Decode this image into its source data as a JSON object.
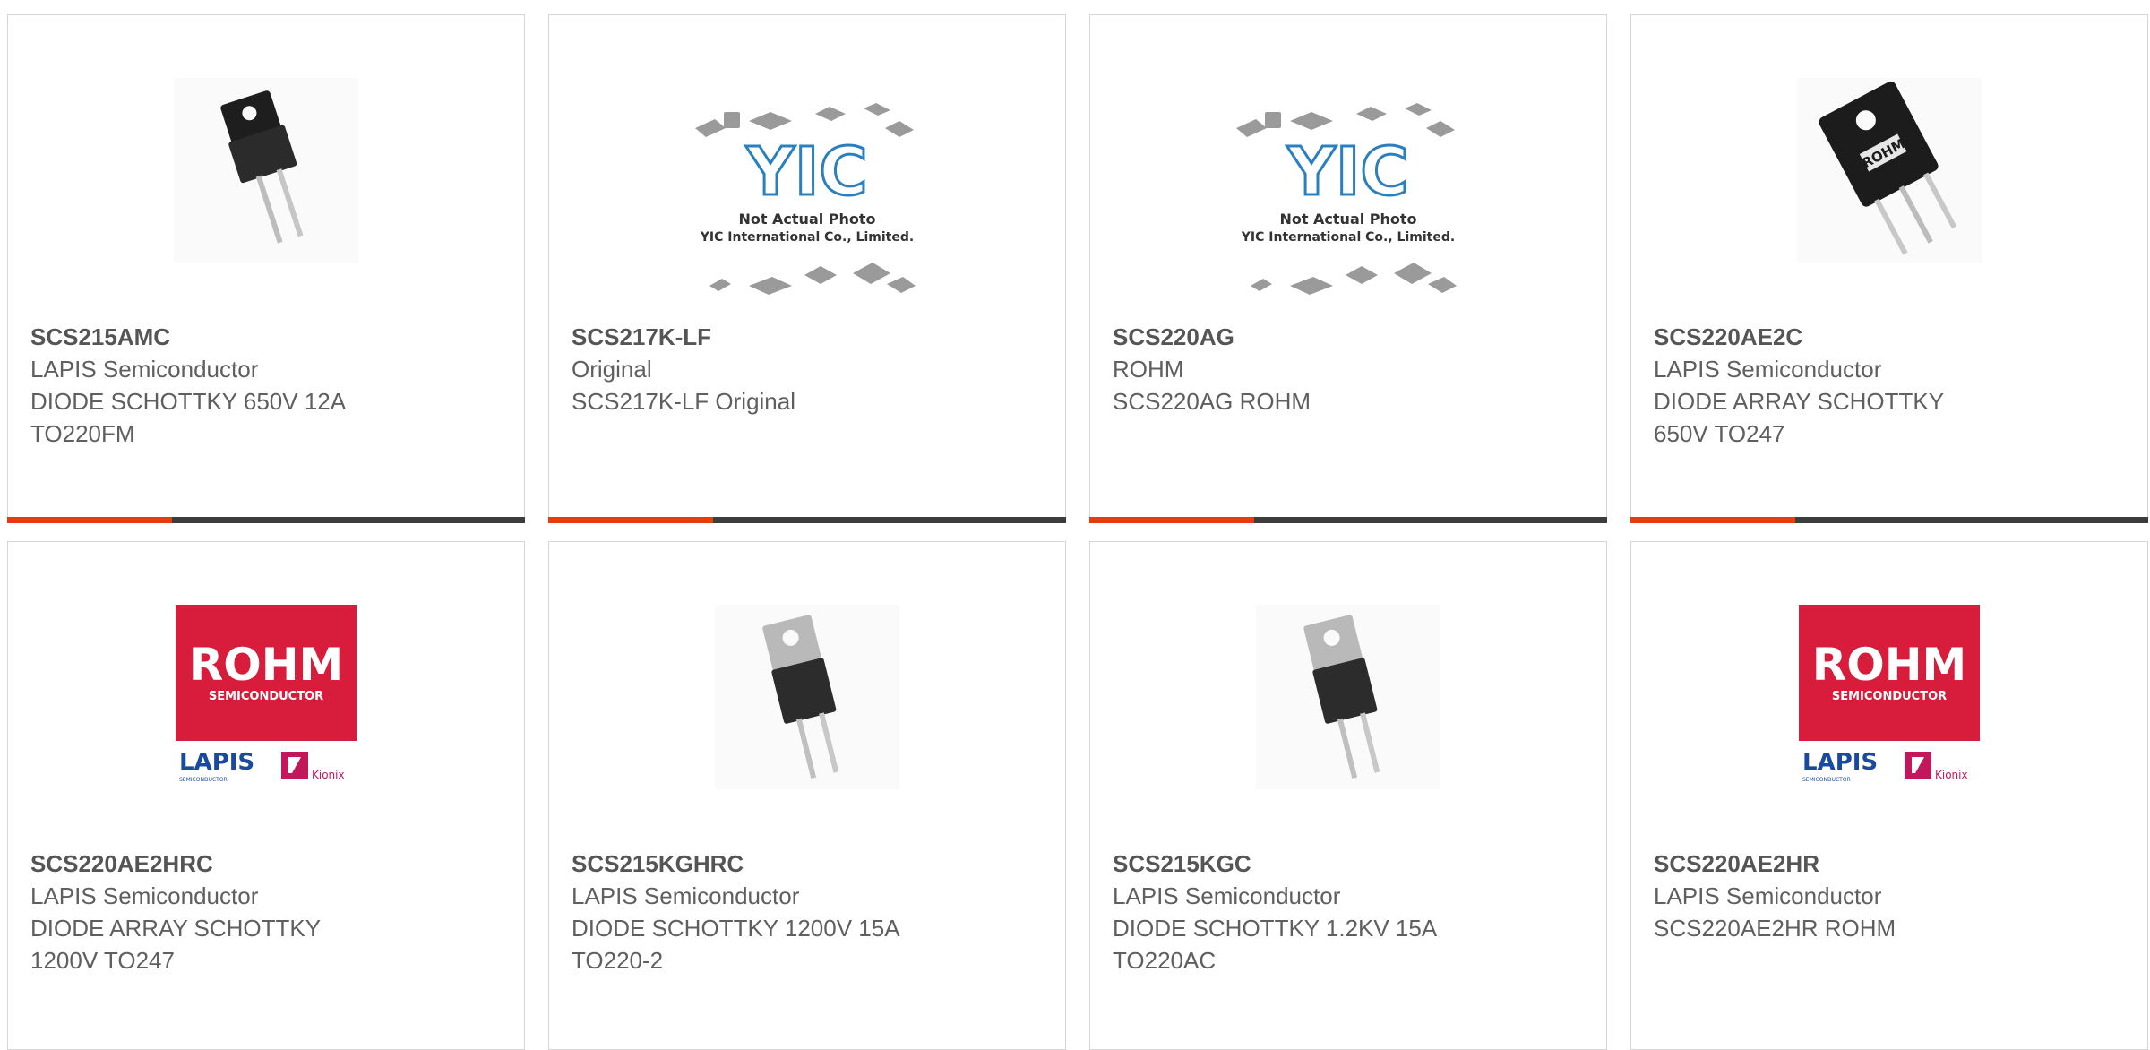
{
  "brand_colors": {
    "accent": "#e53c12",
    "bar_dark": "#3d3d3d",
    "rohm_red": "#d71d3b"
  },
  "products": [
    {
      "part_number": "SCS215AMC",
      "manufacturer": "LAPIS Semiconductor",
      "description_line1": "DIODE SCHOTTKY 650V 12A",
      "description_line2": "TO220FM",
      "image": "to220fm-package-icon"
    },
    {
      "part_number": "SCS217K-LF",
      "manufacturer": "Original",
      "description_line1": "SCS217K-LF Original",
      "description_line2": "",
      "image": "yic-placeholder-icon",
      "image_text": {
        "note": "Not Actual Photo",
        "company": "YIC International Co., Limited."
      }
    },
    {
      "part_number": "SCS220AG",
      "manufacturer": "ROHM",
      "description_line1": "SCS220AG ROHM",
      "description_line2": "",
      "image": "yic-placeholder-icon",
      "image_text": {
        "note": "Not Actual Photo",
        "company": "YIC International Co., Limited."
      }
    },
    {
      "part_number": "SCS220AE2C",
      "manufacturer": "LAPIS Semiconductor",
      "description_line1": "DIODE ARRAY SCHOTTKY",
      "description_line2": "650V TO247",
      "image": "to247-package-icon",
      "image_text": {
        "marking": "ROHM"
      }
    },
    {
      "part_number": "SCS220AE2HRC",
      "manufacturer": "LAPIS Semiconductor",
      "description_line1": "DIODE ARRAY SCHOTTKY",
      "description_line2": "1200V TO247",
      "image": "rohm-lapis-logo",
      "image_text": {
        "brand": "ROHM",
        "sub": "SEMICONDUCTOR",
        "lapis": "LAPIS",
        "lapis_sub": "SEMICONDUCTOR",
        "kionix": "Kionix"
      }
    },
    {
      "part_number": "SCS215KGHRC",
      "manufacturer": "LAPIS Semiconductor",
      "description_line1": "DIODE SCHOTTKY 1200V 15A",
      "description_line2": "TO220-2",
      "image": "to220-2-package-icon"
    },
    {
      "part_number": "SCS215KGC",
      "manufacturer": "LAPIS Semiconductor",
      "description_line1": "DIODE SCHOTTKY 1.2KV 15A",
      "description_line2": "TO220AC",
      "image": "to220-2-package-icon"
    },
    {
      "part_number": "SCS220AE2HR",
      "manufacturer": "LAPIS Semiconductor",
      "description_line1": "SCS220AE2HR ROHM",
      "description_line2": "",
      "image": "rohm-lapis-logo",
      "image_text": {
        "brand": "ROHM",
        "sub": "SEMICONDUCTOR",
        "lapis": "LAPIS",
        "lapis_sub": "SEMICONDUCTOR",
        "kionix": "Kionix"
      }
    }
  ]
}
